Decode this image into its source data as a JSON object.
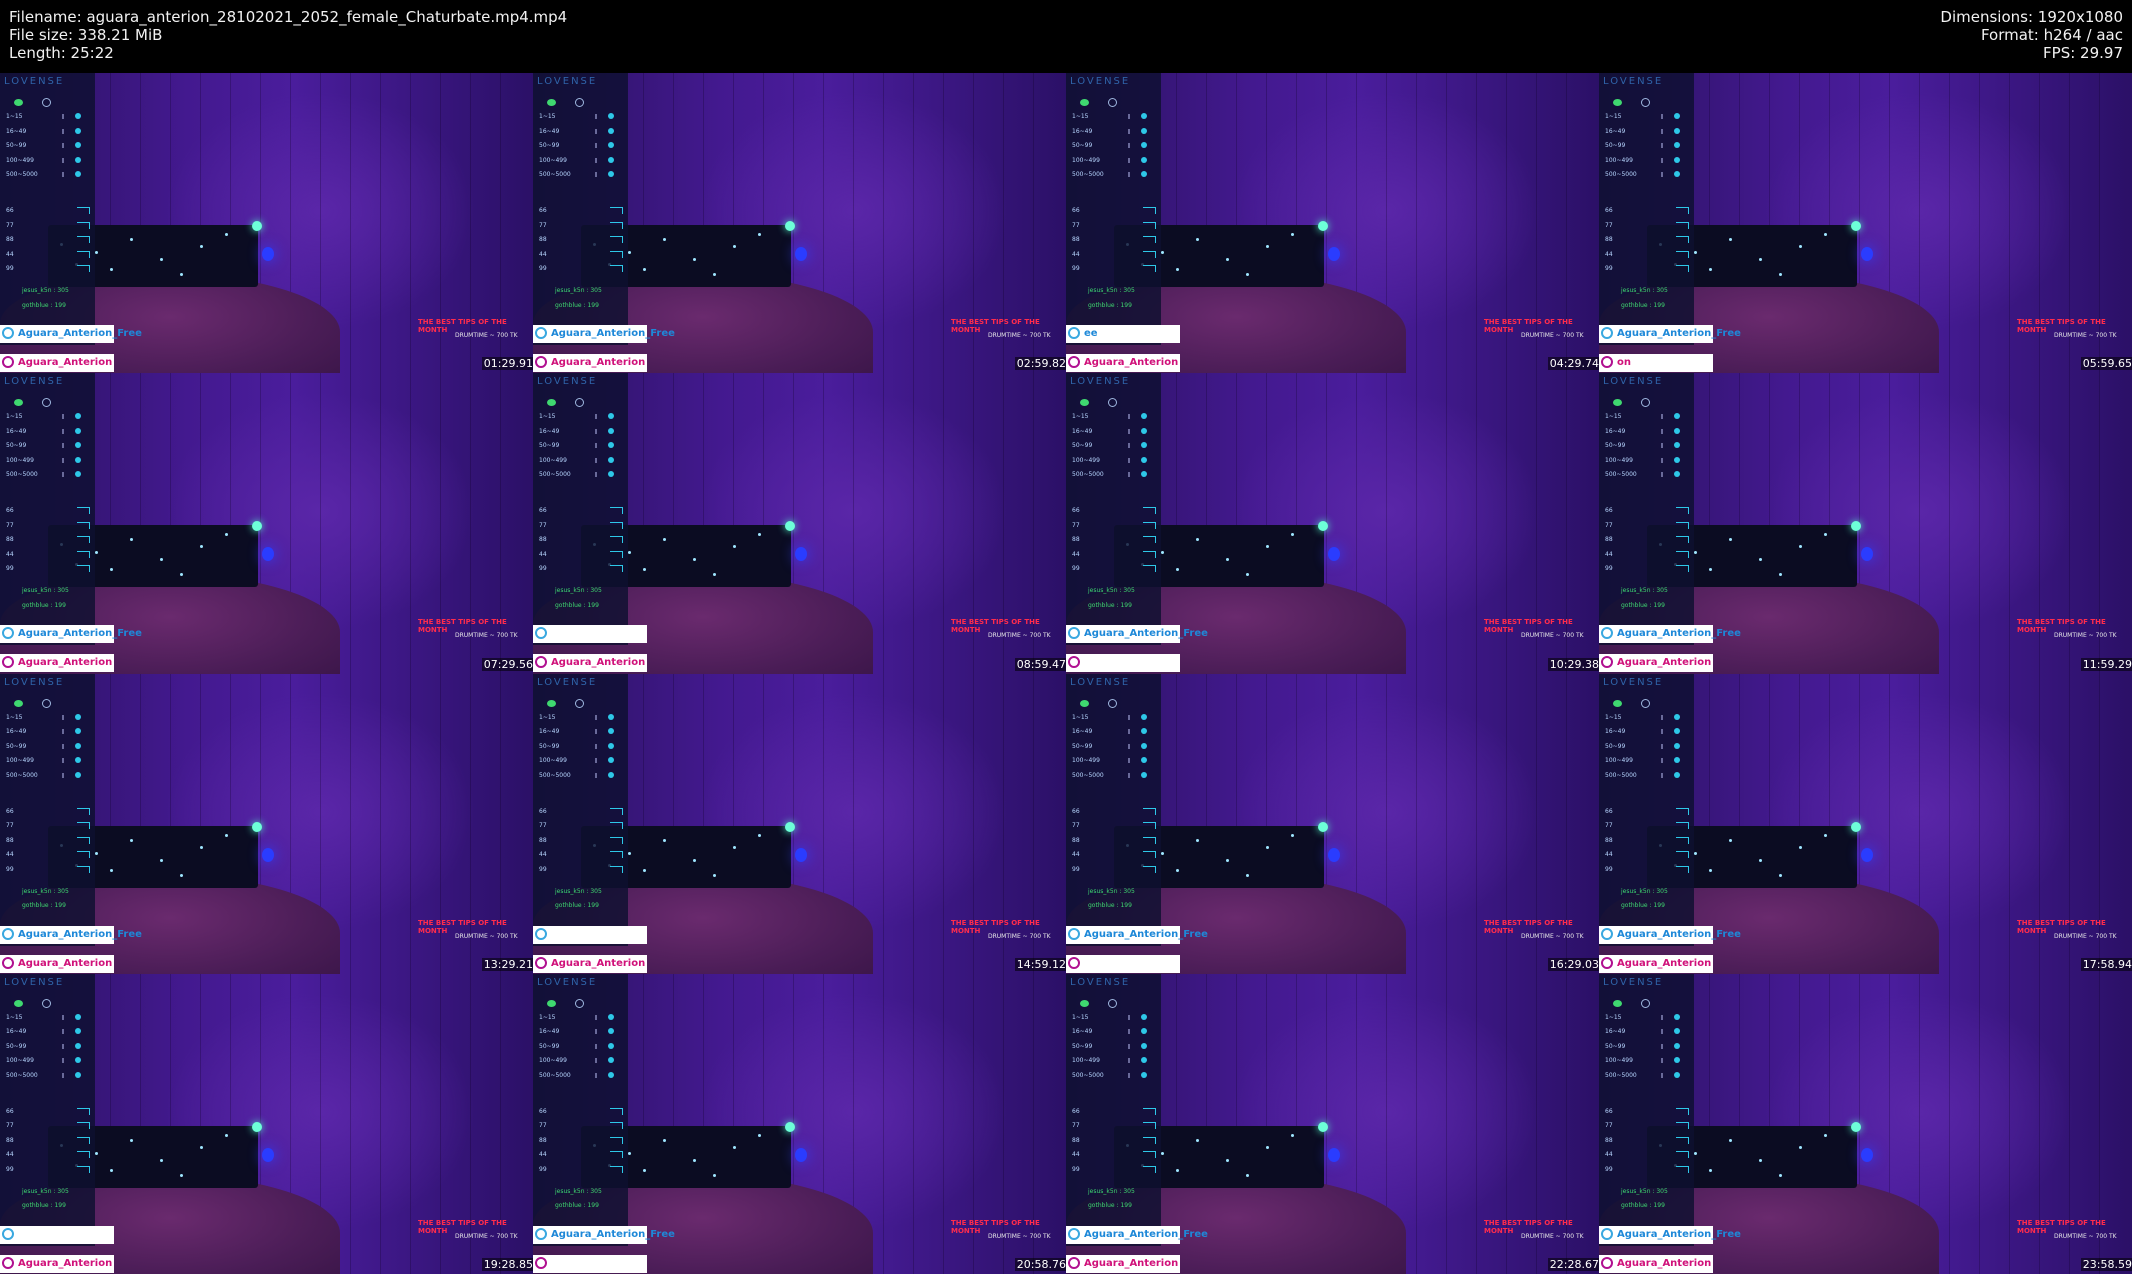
{
  "header": {
    "filename_line": "Filename: aguara_anterion_28102021_2052_female_Chaturbate.mp4.mp4",
    "filesize_line": "File size: 338.21 MiB",
    "length_line": "Length: 25:22",
    "dimensions_line": "Dimensions: 1920x1080",
    "format_line": "Format: h264 / aac",
    "fps_line": "FPS: 29.97"
  },
  "overlay": {
    "logo": "LOVENSE",
    "levels": [
      "1~15",
      "16~49",
      "50~99",
      "100~499",
      "500~5000"
    ],
    "patterns": [
      "66",
      "77",
      "88",
      "44",
      "99"
    ],
    "tippers": [
      "jesus_k5n : 305",
      "gothblue : 199"
    ],
    "tips_banner": "THE BEST TIPS OF THE MONTH",
    "drumtime": "DRUMTIME ~ 700 TK",
    "badge_free": "Aguara_Anterion_Free",
    "badge_main": "Aguara_Anterion"
  },
  "tiles": [
    {
      "timestamp": "01:29.91",
      "badge1": "Aguara_Anterion_Free",
      "badge2": "Aguara_Anterion"
    },
    {
      "timestamp": "02:59.82",
      "badge1": "Aguara_Anterion_Free",
      "badge2": "Aguara_Anterion"
    },
    {
      "timestamp": "04:29.74",
      "badge1": "ee",
      "badge2": "Aguara_Anterion"
    },
    {
      "timestamp": "05:59.65",
      "badge1": "Aguara_Anterion_Free",
      "badge2": "on"
    },
    {
      "timestamp": "07:29.56",
      "badge1": "Aguara_Anterion_Free",
      "badge2": "Aguara_Anterion"
    },
    {
      "timestamp": "08:59.47",
      "badge1": "",
      "badge2": "Aguara_Anterion"
    },
    {
      "timestamp": "10:29.38",
      "badge1": "Aguara_Anterion_Free",
      "badge2": ""
    },
    {
      "timestamp": "11:59.29",
      "badge1": "Aguara_Anterion_Free",
      "badge2": "Aguara_Anterion"
    },
    {
      "timestamp": "13:29.21",
      "badge1": "Aguara_Anterion_Free",
      "badge2": "Aguara_Anterion"
    },
    {
      "timestamp": "14:59.12",
      "badge1": "",
      "badge2": "Aguara_Anterion"
    },
    {
      "timestamp": "16:29.03",
      "badge1": "Aguara_Anterion_Free",
      "badge2": ""
    },
    {
      "timestamp": "17:58.94",
      "badge1": "Aguara_Anterion_Free",
      "badge2": "Aguara_Anterion"
    },
    {
      "timestamp": "19:28.85",
      "badge1": "",
      "badge2": "Aguara_Anterion"
    },
    {
      "timestamp": "20:58.76",
      "badge1": "Aguara_Anterion_Free",
      "badge2": ""
    },
    {
      "timestamp": "22:28.67",
      "badge1": "Aguara_Anterion_Free",
      "badge2": "Aguara_Anterion"
    },
    {
      "timestamp": "23:58.59",
      "badge1": "Aguara_Anterion_Free",
      "badge2": "Aguara_Anterion"
    }
  ]
}
